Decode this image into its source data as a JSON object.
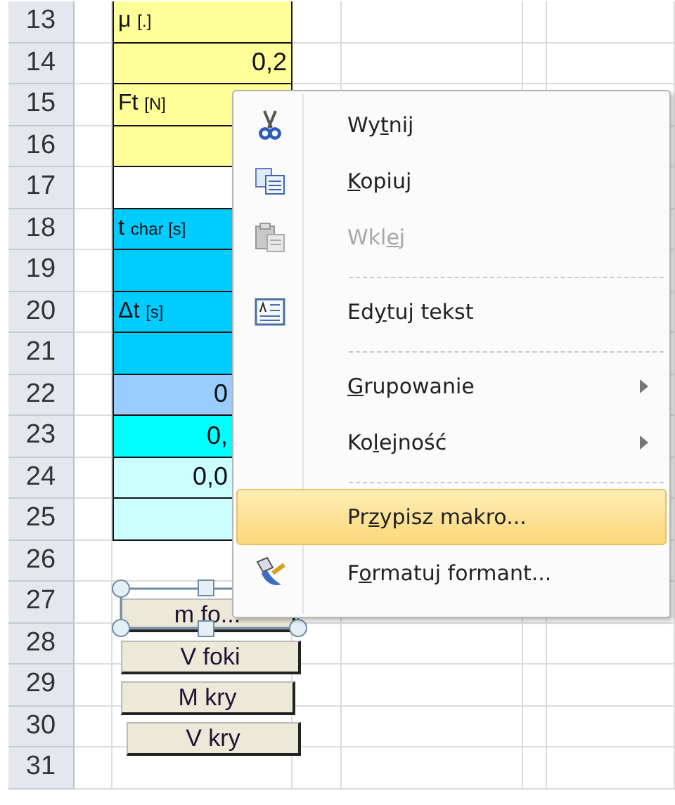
{
  "rows": [
    {
      "number": "13",
      "cell": {
        "color": "#ffff99",
        "symbol": "μ",
        "unit": "[.]"
      }
    },
    {
      "number": "14",
      "cell": {
        "color": "#ffff99",
        "value": "0,2"
      }
    },
    {
      "number": "15",
      "cell": {
        "color": "#ffff99",
        "symbol": "Ft",
        "unit": "[N]"
      }
    },
    {
      "number": "16",
      "cell": {
        "color": "#ffff99"
      }
    },
    {
      "number": "17",
      "cell": {
        "color": "#ffffff"
      }
    },
    {
      "number": "18",
      "cell": {
        "color": "#00ccff",
        "symbol": "t",
        "unit": "char [s]"
      }
    },
    {
      "number": "19",
      "cell": {
        "color": "#00ccff"
      }
    },
    {
      "number": "20",
      "cell": {
        "color": "#00ccff",
        "symbol": "Δt",
        "unit": "[s]"
      }
    },
    {
      "number": "21",
      "cell": {
        "color": "#00ccff"
      }
    },
    {
      "number": "22",
      "cell": {
        "color": "#99ccff",
        "value": "0"
      }
    },
    {
      "number": "23",
      "cell": {
        "color": "#00ffff",
        "value": "0,"
      }
    },
    {
      "number": "24",
      "cell": {
        "color": "#ccffff",
        "value": "0,0"
      }
    },
    {
      "number": "25",
      "cell": {
        "color": "#ccffff"
      }
    },
    {
      "number": "26"
    },
    {
      "number": "27"
    },
    {
      "number": "28"
    },
    {
      "number": "29"
    },
    {
      "number": "30"
    },
    {
      "number": "31"
    }
  ],
  "buttons": [
    {
      "label": "m fo...",
      "selected": true
    },
    {
      "label": "V foki",
      "selected": false
    },
    {
      "label": "M kry",
      "selected": false
    },
    {
      "label": "V kry",
      "selected": false
    }
  ],
  "context_menu": {
    "items": [
      {
        "kind": "command",
        "before": "Wy",
        "key": "t",
        "after": "nij",
        "disabled": false,
        "selected": false,
        "submenu": false
      },
      {
        "kind": "command",
        "key": "K",
        "after": "opiuj",
        "disabled": false,
        "selected": false,
        "submenu": false
      },
      {
        "kind": "command",
        "before": "Wkl",
        "key": "e",
        "after": "j",
        "disabled": true,
        "selected": false,
        "submenu": false
      },
      {
        "kind": "separator"
      },
      {
        "kind": "command",
        "before": "Ed",
        "key": "y",
        "after": "tuj tekst",
        "disabled": false,
        "selected": false,
        "submenu": false
      },
      {
        "kind": "separator"
      },
      {
        "kind": "command",
        "key": "G",
        "after": "rupowanie",
        "disabled": false,
        "selected": false,
        "submenu": true
      },
      {
        "kind": "command",
        "before": "Ko",
        "key": "l",
        "after": "ejność",
        "disabled": false,
        "selected": false,
        "submenu": true
      },
      {
        "kind": "separator"
      },
      {
        "kind": "command",
        "before": "Pr",
        "key": "z",
        "after": "ypisz makro...",
        "disabled": false,
        "selected": true,
        "submenu": false
      },
      {
        "kind": "command",
        "before": "F",
        "key": "o",
        "after": "rmatuj formant...",
        "disabled": false,
        "selected": false,
        "submenu": false
      }
    ]
  }
}
